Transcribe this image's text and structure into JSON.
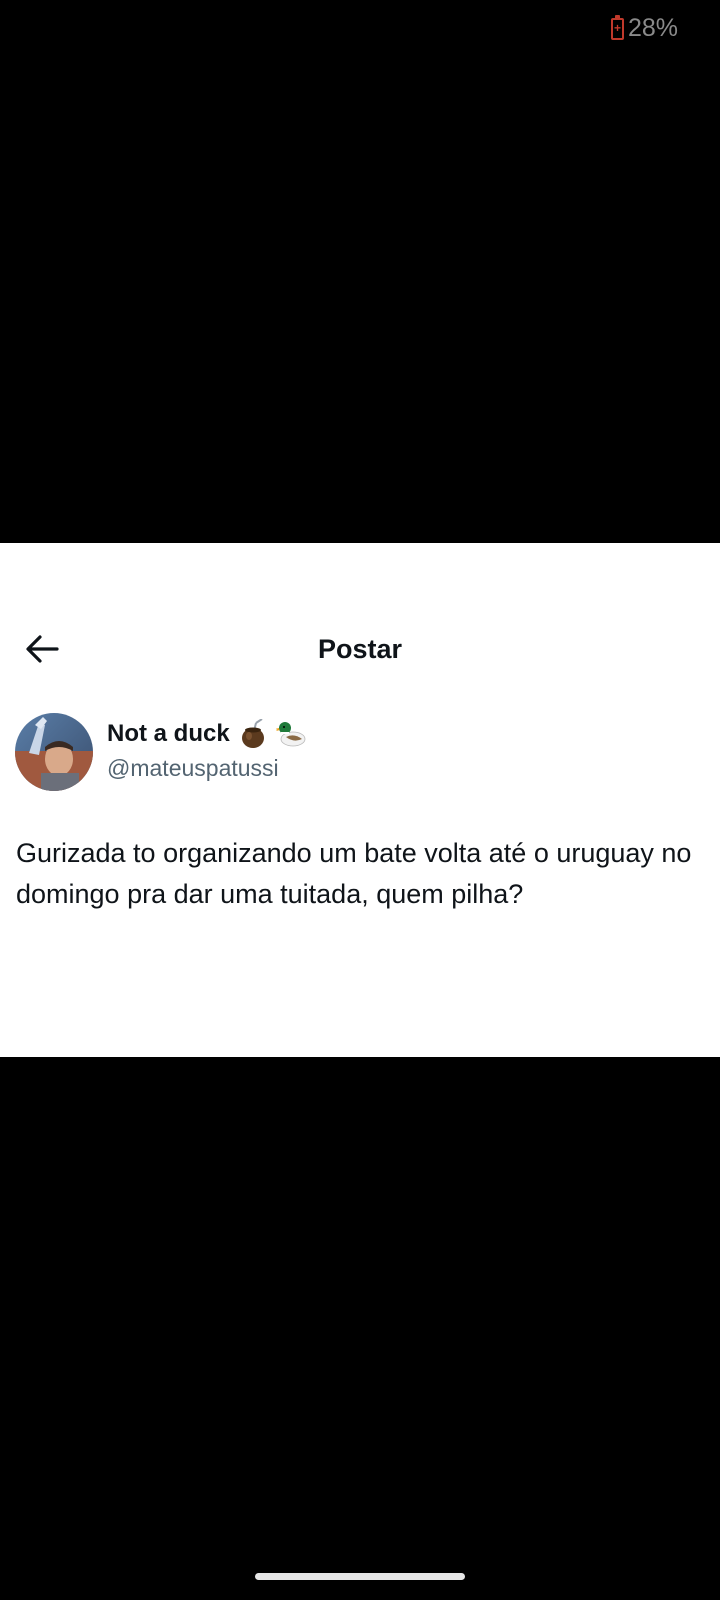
{
  "status_bar": {
    "battery_percent": "28%",
    "battery_icon": "battery-low-charging-icon",
    "battery_color": "#c0392b"
  },
  "header": {
    "back_icon": "arrow-left-icon",
    "title": "Postar"
  },
  "post": {
    "author": {
      "display_name": "Not a duck",
      "name_emojis": [
        "mate-gourd-icon",
        "duck-icon"
      ],
      "handle": "@mateuspatussi",
      "avatar": "profile-photo"
    },
    "text": "Gurizada to organizando um bate volta até o uruguay no domingo pra dar uma tuitada, quem pilha?"
  },
  "colors": {
    "background": "#000000",
    "card": "#ffffff",
    "primary_text": "#0f1419",
    "secondary_text": "#536471"
  }
}
